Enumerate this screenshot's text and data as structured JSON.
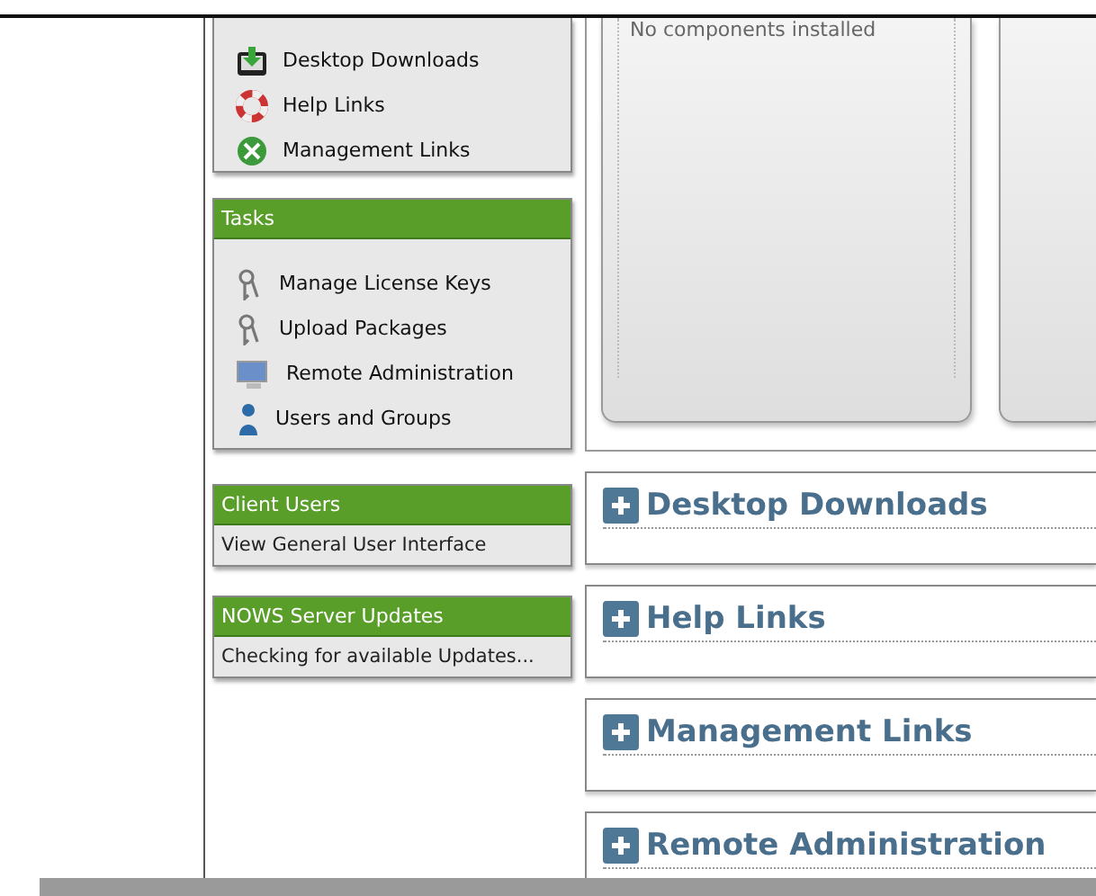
{
  "sidebar": {
    "top_panel": {
      "items": [
        {
          "label": "Desktop Downloads",
          "kind": "download"
        },
        {
          "label": "Help Links",
          "kind": "lifebuoy"
        },
        {
          "label": "Management Links",
          "kind": "tools"
        }
      ]
    },
    "panels": [
      {
        "title": "Tasks",
        "items": [
          {
            "label": "Manage License Keys",
            "kind": "keys"
          },
          {
            "label": "Upload Packages",
            "kind": "keys"
          },
          {
            "label": "Remote Administration",
            "kind": "monitor"
          },
          {
            "label": "Users and Groups",
            "kind": "user"
          }
        ]
      },
      {
        "title": "Client Users",
        "items": [
          {
            "label": "View General User Interface",
            "kind": "text"
          }
        ]
      },
      {
        "title": "NOWS Server Updates",
        "items": [
          {
            "label": "Checking for available Updates...",
            "kind": "text"
          }
        ]
      }
    ]
  },
  "main": {
    "card_text": "No components installed",
    "sections": [
      "Desktop Downloads",
      "Help Links",
      "Management Links",
      "Remote Administration"
    ]
  }
}
